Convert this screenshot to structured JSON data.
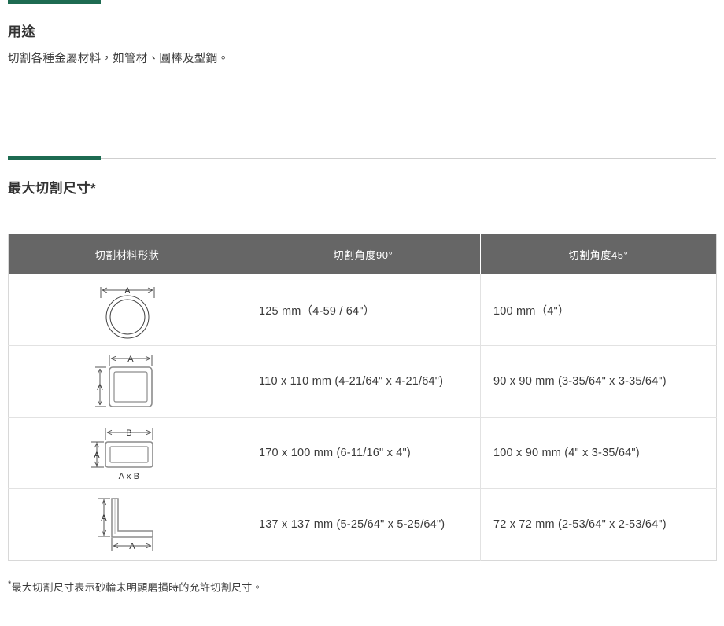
{
  "theme": {
    "accent_green": "#1d6b51",
    "rule_grey": "#cfcfcf",
    "table_header_bg": "#666666",
    "table_border": "#e2e2e2",
    "text_color": "#3a3a3a"
  },
  "sections": {
    "usage": {
      "title": "用途",
      "body": "切割各種金屬材料，如管材、圓棒及型鋼。"
    },
    "max_cut": {
      "title": "最大切割尺寸*"
    }
  },
  "table": {
    "headers": [
      "切割材料形狀",
      "切割角度90°",
      "切割角度45°"
    ],
    "rows": [
      {
        "shape_icon": "round-tube-shape-icon",
        "shape_labels": {
          "top": "A"
        },
        "angle_90": "125 mm（4-59 / 64\"）",
        "angle_45": "100 mm（4\"）"
      },
      {
        "shape_icon": "square-tube-shape-icon",
        "shape_labels": {
          "top": "A",
          "left": "A"
        },
        "angle_90": "110 x 110 mm (4-21/64\" x 4-21/64\")",
        "angle_45": "90 x 90 mm (3-35/64\" x 3-35/64\")"
      },
      {
        "shape_icon": "rectangular-tube-shape-icon",
        "shape_labels": {
          "top": "B",
          "left": "A",
          "bottom": "A x B"
        },
        "angle_90": "170 x 100 mm (6-11/16\" x 4\")",
        "angle_45": "100 x 90 mm (4\" x 3-35/64\")"
      },
      {
        "shape_icon": "angle-iron-shape-icon",
        "shape_labels": {
          "left": "A",
          "bottom": "A"
        },
        "angle_90": "137 x 137 mm (5-25/64\" x 5-25/64\")",
        "angle_45": "72 x 72 mm (2-53/64\" x 2-53/64\")"
      }
    ]
  },
  "footnote": {
    "star": "*",
    "text": "最大切割尺寸表示砂輪未明顯磨損時的允許切割尺寸。"
  }
}
